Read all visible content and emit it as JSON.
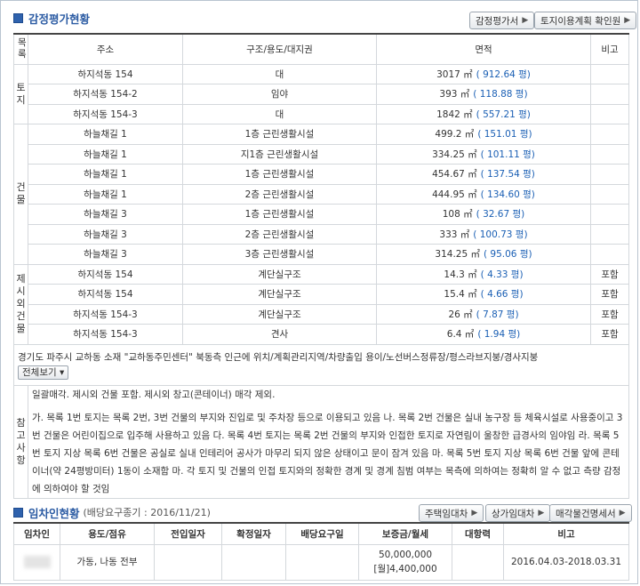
{
  "appraisal": {
    "title": "감정평가현황",
    "btn_report": "감정평가서",
    "btn_land_plan": "토지이용계획 확인원",
    "headers": {
      "category": "목록",
      "address": "주소",
      "structure": "구조/용도/대지권",
      "area": "면적",
      "note": "비고"
    },
    "groups": {
      "land": "토지",
      "building": "건물",
      "excluded": "제시외건물"
    },
    "land_rows": [
      {
        "address": "하지석동 154",
        "structure": "대",
        "area": "3017 ㎡",
        "pyeong": "( 912.64 평)",
        "note": ""
      },
      {
        "address": "하지석동 154-2",
        "structure": "임야",
        "area": "393 ㎡",
        "pyeong": "( 118.88 평)",
        "note": ""
      },
      {
        "address": "하지석동 154-3",
        "structure": "대",
        "area": "1842 ㎡",
        "pyeong": "( 557.21 평)",
        "note": ""
      }
    ],
    "building_rows": [
      {
        "address": "하늘채길 1",
        "structure": "1층 근린생활시설",
        "area": "499.2 ㎡",
        "pyeong": "( 151.01 평)",
        "note": ""
      },
      {
        "address": "하늘채길 1",
        "structure": "지1층 근린생활시설",
        "area": "334.25 ㎡",
        "pyeong": "( 101.11 평)",
        "note": ""
      },
      {
        "address": "하늘채길 1",
        "structure": "1층 근린생활시설",
        "area": "454.67 ㎡",
        "pyeong": "( 137.54 평)",
        "note": ""
      },
      {
        "address": "하늘채길 1",
        "structure": "2층 근린생활시설",
        "area": "444.95 ㎡",
        "pyeong": "( 134.60 평)",
        "note": ""
      },
      {
        "address": "하늘채길 3",
        "structure": "1층 근린생활시설",
        "area": "108 ㎡",
        "pyeong": "( 32.67 평)",
        "note": ""
      },
      {
        "address": "하늘채길 3",
        "structure": "2층 근린생활시설",
        "area": "333 ㎡",
        "pyeong": "( 100.73 평)",
        "note": ""
      },
      {
        "address": "하늘채길 3",
        "structure": "3층 근린생활시설",
        "area": "314.25 ㎡",
        "pyeong": "( 95.06 평)",
        "note": ""
      }
    ],
    "excluded_rows": [
      {
        "address": "하지석동 154",
        "structure": "계단실구조",
        "area": "14.3 ㎡",
        "pyeong": "( 4.33 평)",
        "note": "포함"
      },
      {
        "address": "하지석동 154",
        "structure": "계단실구조",
        "area": "15.4 ㎡",
        "pyeong": "( 4.66 평)",
        "note": "포함"
      },
      {
        "address": "하지석동 154-3",
        "structure": "계단실구조",
        "area": "26 ㎡",
        "pyeong": "( 7.87 평)",
        "note": "포함"
      },
      {
        "address": "하지석동 154-3",
        "structure": "견사",
        "area": "6.4 ㎡",
        "pyeong": "( 1.94 평)",
        "note": "포함"
      }
    ],
    "location_note": "경기도 파주시 교하동 소재 \"교하동주민센터\" 북동측 인근에 위치/계획관리지역/차량출입 용이/노선버스정류장/평스라브지붕/경사지붕",
    "expand_label": "전체보기",
    "ref_label": "참고사항",
    "ref_line1": "일괄매각. 제시외 건물 포함. 제시외 창고(콘테이너) 매각 제외.",
    "ref_line2": "가. 목록 1번 토지는 목록 2번, 3번 건물의 부지와 진입로 및 주차장 등으로 이용되고 있음 나. 목록 2번 건물은 실내 농구장 등 체육시설로 사용중이고 3번 건물은 어린이집으로 입주해 사용하고 있음 다. 목록 4번 토지는 목록 2번 건물의 부지와 인접한 토지로 자연림이 울창한 급경사의 임야임 라. 목록 5번 토지 지상 목록 6번 건물은 공실로 실내 인테리어 공사가 마무리 되지 않은 상태이고 문이 잠겨 있음 마. 목록 5번 토지 지상 목록 6번 건물 앞에 콘테이너(약 24평방미터) 1동이 소재함 마. 각 토지 및 건물의 인접 토지와의 정확한 경계 및 경계 침범 여부는 목측에 의하여는 정확히 알 수 없고 측량 감정에 의하여야 할 것임"
  },
  "tenants": {
    "title": "임차인현황",
    "subtitle": "(배당요구종기 : 2016/11/21)",
    "btn_house_lease": "주택임대차",
    "btn_store_lease": "상가임대차",
    "btn_property_statement": "매각물건명세서",
    "headers": [
      "임차인",
      "용도/점유",
      "전입일자",
      "확정일자",
      "배당요구일",
      "보증금/월세",
      "대항력",
      "비고"
    ],
    "row": {
      "usage": "가동, 나동 전부",
      "move_in": "",
      "fixed_date": "",
      "claim_date": "",
      "deposit": "50,000,000",
      "monthly": "[월]4,400,000",
      "opposing": "",
      "note": "2016.04.03-2018.03.31"
    }
  }
}
